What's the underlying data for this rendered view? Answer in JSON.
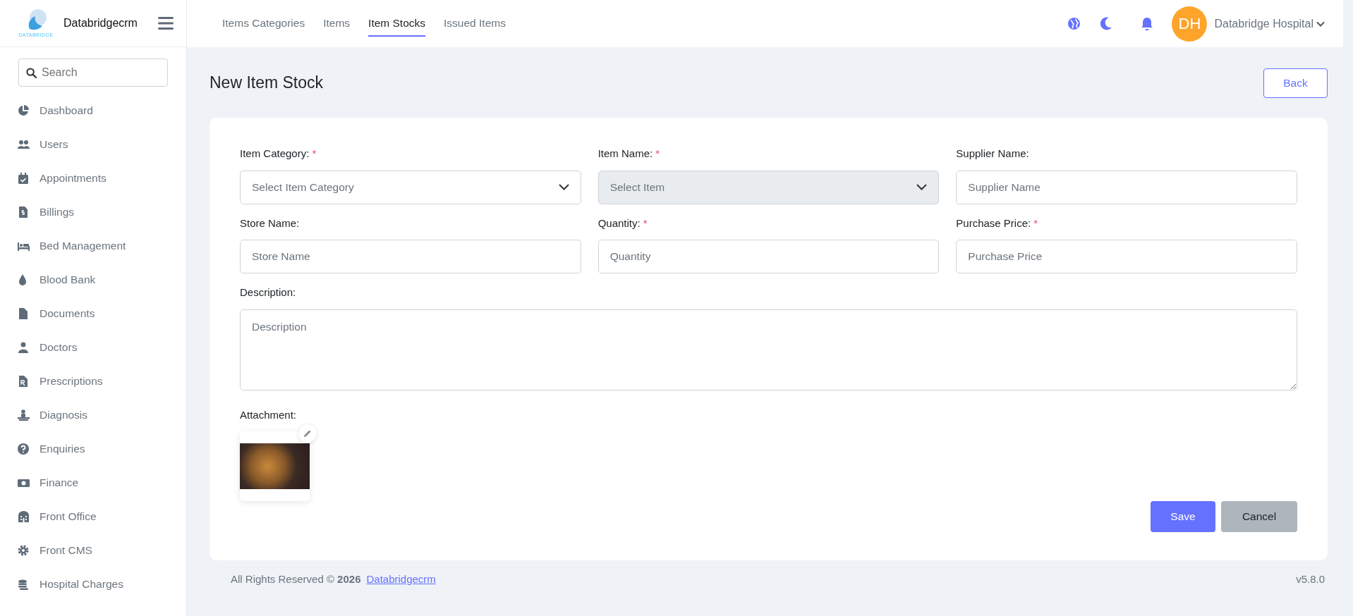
{
  "sidebar": {
    "brand": "Databridgecrm",
    "logo_text": "DATABRIDGE",
    "search": {
      "placeholder": "Search"
    },
    "items": [
      {
        "label": "Dashboard"
      },
      {
        "label": "Users"
      },
      {
        "label": "Appointments"
      },
      {
        "label": "Billings"
      },
      {
        "label": "Bed Management"
      },
      {
        "label": "Blood Bank"
      },
      {
        "label": "Documents"
      },
      {
        "label": "Doctors"
      },
      {
        "label": "Prescriptions"
      },
      {
        "label": "Diagnosis"
      },
      {
        "label": "Enquiries"
      },
      {
        "label": "Finance"
      },
      {
        "label": "Front Office"
      },
      {
        "label": "Front CMS"
      },
      {
        "label": "Hospital Charges"
      }
    ]
  },
  "tabs": [
    {
      "label": "Items Categories",
      "selected": false
    },
    {
      "label": "Items",
      "selected": false
    },
    {
      "label": "Item Stocks",
      "selected": true
    },
    {
      "label": "Issued Items",
      "selected": false
    }
  ],
  "user": {
    "initials": "DH",
    "name": "Databridge Hospital"
  },
  "page": {
    "title": "New Item Stock",
    "back_button": "Back"
  },
  "form": {
    "fields": [
      {
        "kind": "select",
        "label": "Item Category:",
        "required_mark": "*",
        "placeholder": "Select Item Category",
        "disabled": false
      },
      {
        "kind": "select",
        "label": "Item Name:",
        "required_mark": "*",
        "placeholder": "Select Item",
        "disabled": true
      },
      {
        "kind": "input",
        "label": "Supplier Name:",
        "placeholder": "Supplier Name",
        "disabled": false
      },
      {
        "kind": "input",
        "label": "Store Name:",
        "placeholder": "Store Name",
        "disabled": false
      },
      {
        "kind": "input",
        "label": "Quantity:",
        "required_mark": "*",
        "placeholder": "Quantity",
        "disabled": false
      },
      {
        "kind": "input",
        "label": "Purchase Price:",
        "required_mark": "*",
        "placeholder": "Purchase Price",
        "disabled": false
      },
      {
        "kind": "textarea",
        "label": "Description:",
        "placeholder": "Description",
        "disabled": false
      }
    ],
    "attachment_label": "Attachment:",
    "buttons": [
      {
        "label": "Save",
        "kind": "primary"
      },
      {
        "label": "Cancel",
        "kind": "secondary"
      }
    ]
  },
  "footer": {
    "copyright": "All Rights Reserved © **2026**",
    "link": "Databridgecrm",
    "version": "v5.8.0"
  }
}
